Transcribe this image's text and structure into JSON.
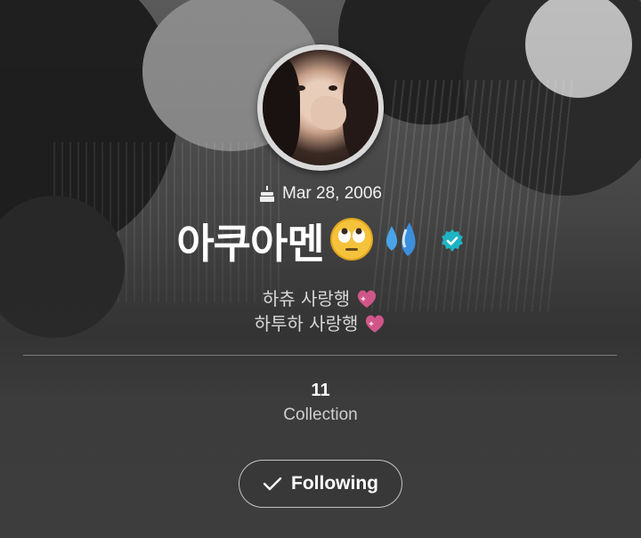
{
  "profile": {
    "birthday": "Mar 28, 2006",
    "name": "아쿠아멘",
    "name_emojis": [
      "🙄",
      "💦"
    ],
    "verified": true,
    "bio_lines": [
      {
        "text": "하츄 사랑행",
        "emoji": "💖"
      },
      {
        "text": "하투하 사랑행",
        "emoji": "💖"
      }
    ]
  },
  "stats": {
    "collection_count": "11",
    "collection_label": "Collection"
  },
  "actions": {
    "follow_label": "Following"
  },
  "icons": {
    "birthday": "cake-icon",
    "verified": "verified-badge-icon",
    "follow_state": "check-icon",
    "bio_decoration": "sparkling-heart-icon"
  },
  "colors": {
    "verified_badge": "#1fb3c4",
    "heart": "#d0568a"
  }
}
